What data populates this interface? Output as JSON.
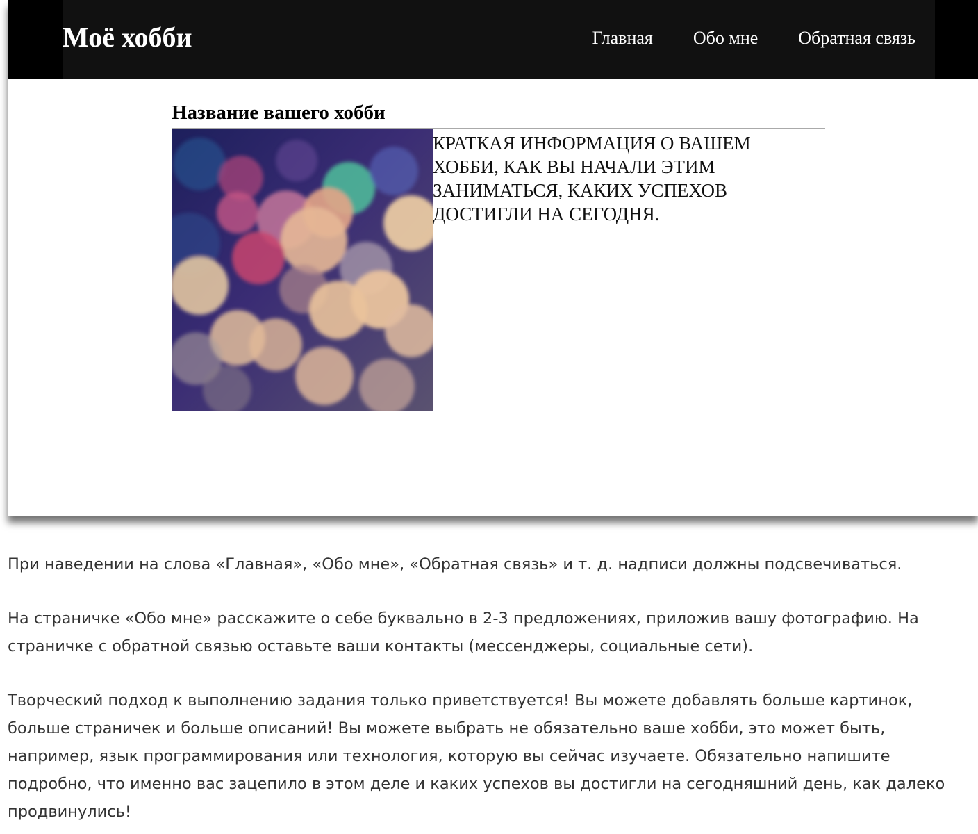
{
  "site": {
    "title": "Моё хобби",
    "nav": [
      {
        "label": "Главная"
      },
      {
        "label": "Обо мне"
      },
      {
        "label": "Обратная связь"
      }
    ]
  },
  "hobby": {
    "title": "Название вашего хобби",
    "description": "КРАТКАЯ ИНФОРМАЦИЯ О ВАШЕМ ХОББИ, КАК ВЫ НАЧАЛИ ЭТИМ ЗАНИМАТЬСЯ, КАКИХ УСПЕХОВ ДОСТИГЛИ НА СЕГОДНЯ.",
    "image_icon": "bokeh-photo"
  },
  "instructions": [
    "При наведении на слова «Главная», «Обо мне», «Обратная связь» и т. д. надписи должны подсвечиваться.",
    "На страничке «Обо мне» расскажите о себе буквально в 2-3 предложениях, приложив вашу фотографию. На страничке с обратной связью оставьте ваши контакты (мессенджеры, социальные сети).",
    "Творческий подход к выполнению задания только приветствуется! Вы можете добавлять больше картинок, больше страничек и больше описаний! Вы можете выбрать не обязательно ваше хобби, это может быть, например, язык программирования или технология, которую вы сейчас изучаете. Обязательно напишите подробно, что именно вас зацепило в этом деле и каких успехов вы достигли на сегодняшний день, как далеко продвинулись!"
  ],
  "colors": {
    "navbar_outer": "#000000",
    "navbar_inner": "#111111",
    "nav_text": "#ffffff",
    "body_text": "#333333"
  }
}
